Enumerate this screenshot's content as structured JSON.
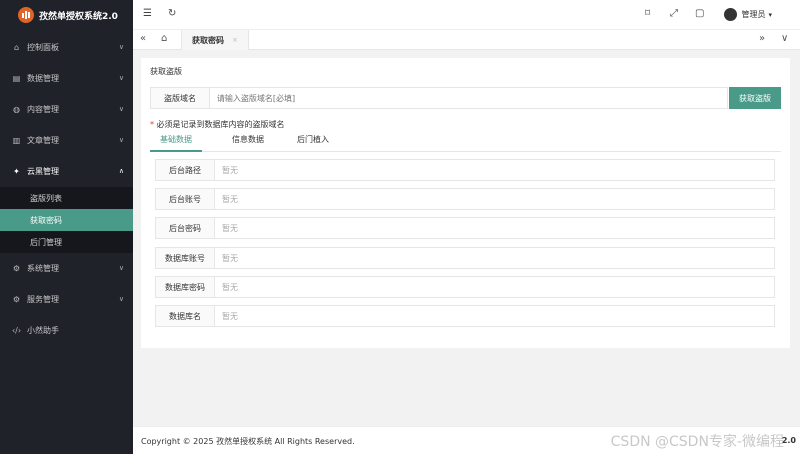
{
  "app": {
    "title": "孜然单授权系统2.0"
  },
  "sidebar": {
    "items": [
      {
        "label": "控制面板",
        "icon": "home-icon"
      },
      {
        "label": "数据管理",
        "icon": "database-icon"
      },
      {
        "label": "内容管理",
        "icon": "globe-icon"
      },
      {
        "label": "文章管理",
        "icon": "book-icon"
      },
      {
        "label": "云黑管理",
        "icon": "magic-icon"
      },
      {
        "label": "系统管理",
        "icon": "gear-icon"
      },
      {
        "label": "服务管理",
        "icon": "server-icon"
      },
      {
        "label": "小然助手",
        "icon": "code-icon"
      }
    ],
    "sub_items": [
      {
        "label": "盗版列表"
      },
      {
        "label": "获取密码"
      },
      {
        "label": "后门管理"
      }
    ]
  },
  "header": {
    "user": "管理员"
  },
  "tabs": {
    "active": "获取密码",
    "close": "×"
  },
  "card": {
    "title": "获取盗版",
    "domain_label": "盗版域名",
    "domain_placeholder": "请输入盗版域名[必填]",
    "submit": "获取盗版",
    "hint_star": "*",
    "hint": "必须是记录到数据库内容的盗版域名",
    "subtabs": [
      "基础数据",
      "信息数据",
      "后门植入"
    ],
    "fields": [
      {
        "label": "后台路径",
        "value": "暂无"
      },
      {
        "label": "后台账号",
        "value": "暂无"
      },
      {
        "label": "后台密码",
        "value": "暂无"
      },
      {
        "label": "数据库账号",
        "value": "暂无"
      },
      {
        "label": "数据库密码",
        "value": "暂无"
      },
      {
        "label": "数据库名",
        "value": "暂无"
      }
    ]
  },
  "footer": {
    "copyright": "Copyright © 2025 孜然单授权系统 All Rights Reserved.",
    "watermark": "CSDN  @CSDN专家-微编程",
    "version": "2.0"
  },
  "colors": {
    "sidebar_bg": "#20222a",
    "accent": "#4a9a8a",
    "logo": "#e0642a"
  }
}
